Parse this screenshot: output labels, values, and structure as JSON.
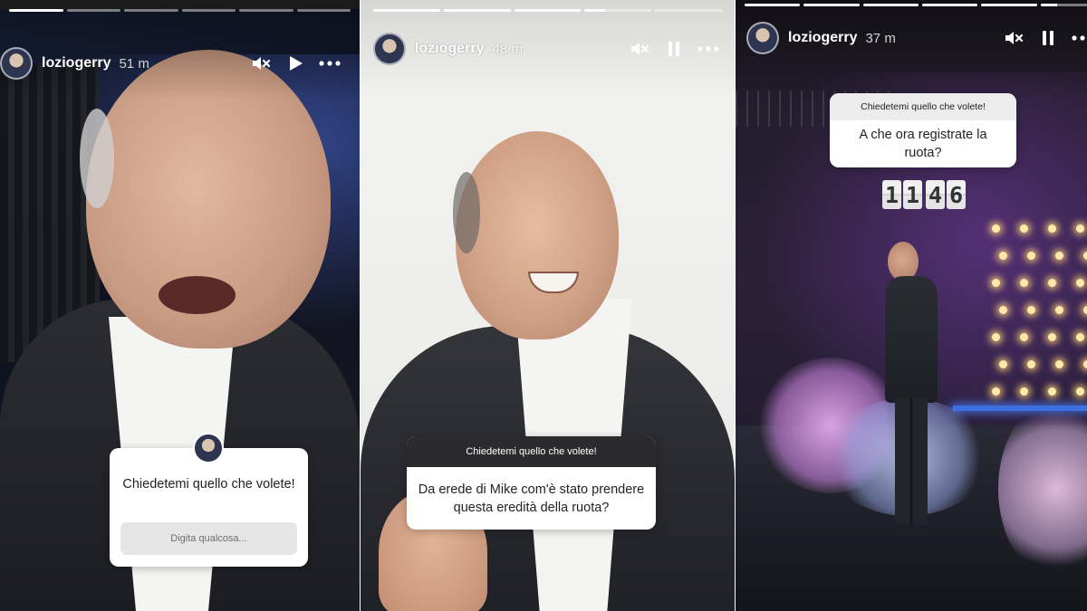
{
  "stories": [
    {
      "username": "loziogerry",
      "time": "51 m",
      "progress": [
        1.0,
        0.0,
        0.0,
        0.0,
        0.0,
        0.0
      ],
      "controls": {
        "mute_icon": "muted-speaker-icon",
        "play_icon": "play-icon",
        "more_icon": "more-icon"
      },
      "question": {
        "title": "Chiedetemi quello che volete!",
        "input_placeholder": "Digita qualcosa..."
      }
    },
    {
      "username": "loziogerry",
      "time": "48 m",
      "progress": [
        1.0,
        1.0,
        1.0,
        0.3,
        0.0
      ],
      "controls": {
        "mute_icon": "muted-speaker-icon",
        "pause_icon": "pause-icon",
        "more_icon": "more-icon"
      },
      "question": {
        "title": "Chiedetemi quello che volete!",
        "answer": "Da erede di Mike com'è stato prendere questa eredità della ruota?"
      }
    },
    {
      "username": "loziogerry",
      "time": "37 m",
      "progress": [
        1.0,
        1.0,
        1.0,
        1.0,
        1.0,
        0.3
      ],
      "controls": {
        "mute_icon": "muted-speaker-icon",
        "pause_icon": "pause-icon",
        "more_icon": "more-icon"
      },
      "question": {
        "title": "Chiedetemi quello che volete!",
        "answer": "A che ora registrate la ruota?"
      },
      "clock_digits": [
        "1",
        "1",
        "4",
        "6"
      ]
    }
  ],
  "colors": {
    "card_header": "#2b2b2d",
    "card_body": "#ffffff",
    "input_bg": "#e6e6e6"
  }
}
